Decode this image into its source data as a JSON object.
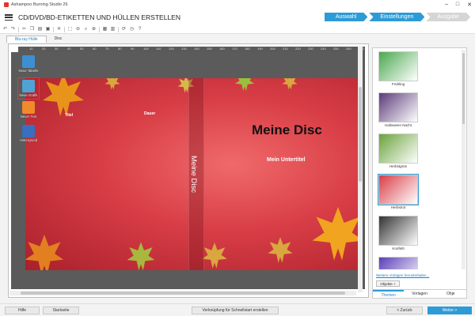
{
  "window": {
    "title": "Ashampoo Burning Studio 26"
  },
  "header": {
    "page_title": "CD/DVD/BD-ETIKETTEN UND HÜLLEN ERSTELLEN",
    "steps": [
      "Auswahl",
      "Einstellungen",
      "Ausgabe"
    ]
  },
  "tabs": [
    "Blu-ray Hülle",
    "Disc"
  ],
  "ruler": {
    "top": [
      "10",
      "20",
      "30",
      "40",
      "50",
      "60",
      "70",
      "80",
      "90",
      "100",
      "110",
      "120",
      "130",
      "140",
      "150",
      "160",
      "170",
      "180",
      "190",
      "200",
      "210",
      "220",
      "230",
      "240",
      "250",
      "260",
      "270"
    ]
  },
  "canvas": {
    "title": "Meine Disc",
    "subtitle": "Mein Untertitel",
    "spine_text": "Meine Disc",
    "back_label_title": "Titel",
    "back_label_duration": "Dauer"
  },
  "side_tools": [
    "Neue Tabelle",
    "Neue Grafik",
    "Neuer Text",
    "Hintergrund"
  ],
  "templates": {
    "items": [
      {
        "name": "Frühling",
        "color": "#4aa84e"
      },
      {
        "name": "Halloween Nacht",
        "color": "#5b3a7a"
      },
      {
        "name": "Herbstgrün",
        "color": "#6aa23a"
      },
      {
        "name": "Herbstrot",
        "color": "#d83d46"
      },
      {
        "name": "Konfetti",
        "color": "#333333"
      },
      {
        "name": "",
        "color": "#5a3fb8"
      }
    ],
    "more_link": "Weitere Vorlagen herunterladen...",
    "objects_button": "Objekte +",
    "tabs": [
      "Themen",
      "Vorlagen",
      "Obje"
    ]
  },
  "footer": {
    "help": "Hilfe",
    "start": "Startseite",
    "shortcut": "Verknüpfung für Schnellstart erstellen",
    "back": "< Zurück",
    "next": "Weiter >"
  }
}
